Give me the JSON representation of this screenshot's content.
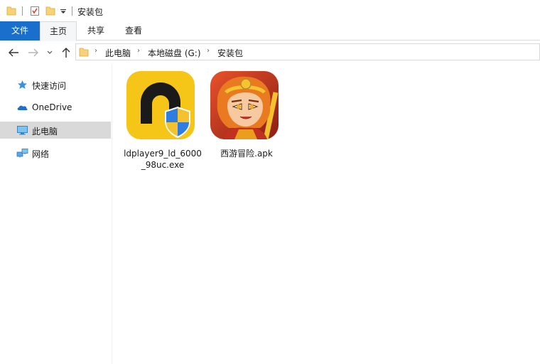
{
  "window": {
    "title": "安装包"
  },
  "ribbon": {
    "tabs": [
      {
        "label": "文件"
      },
      {
        "label": "主页"
      },
      {
        "label": "共享"
      },
      {
        "label": "查看"
      }
    ]
  },
  "address": {
    "breadcrumbs": [
      "此电脑",
      "本地磁盘 (G:)",
      "安装包"
    ]
  },
  "nav": {
    "items": [
      {
        "label": "快速访问",
        "icon": "star-icon"
      },
      {
        "label": "OneDrive",
        "icon": "cloud-icon"
      },
      {
        "label": "此电脑",
        "icon": "computer-icon",
        "selected": true
      },
      {
        "label": "网络",
        "icon": "network-icon"
      }
    ]
  },
  "files": [
    {
      "name": "ldplayer9_ld_6000_98uc.exe",
      "icon": "ldplayer-app-icon"
    },
    {
      "name": "西游冒险.apk",
      "icon": "monkey-king-game-icon"
    }
  ],
  "colors": {
    "accent": "#1a6fcd",
    "selection": "#d9d9d9",
    "folder": "#f7d27a",
    "ldplayer_yellow": "#f5c518"
  }
}
